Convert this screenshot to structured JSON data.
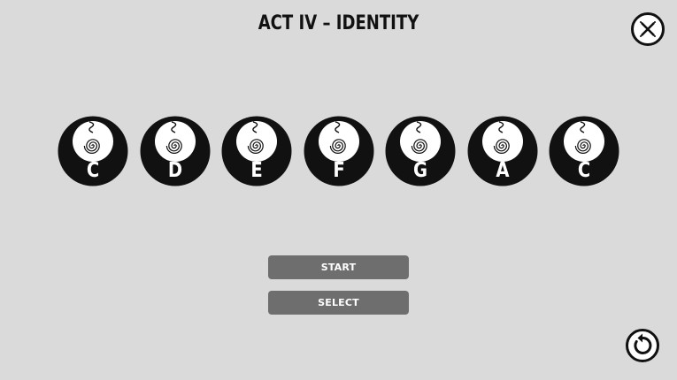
{
  "title": "ACT IV – IDENTITY",
  "icons": {
    "close": "close-icon",
    "replay": "replay-icon",
    "note": "spiral-pendant-icon"
  },
  "colors": {
    "background": "#dadada",
    "note_disc": "#111111",
    "note_inner": "#ffffff",
    "button": "#6e6e6e",
    "button_text": "#ffffff"
  },
  "notes": [
    {
      "label": "C"
    },
    {
      "label": "D"
    },
    {
      "label": "E"
    },
    {
      "label": "F"
    },
    {
      "label": "G"
    },
    {
      "label": "A"
    },
    {
      "label": "C"
    }
  ],
  "menu": {
    "start_label": "START",
    "select_label": "SELECT"
  }
}
